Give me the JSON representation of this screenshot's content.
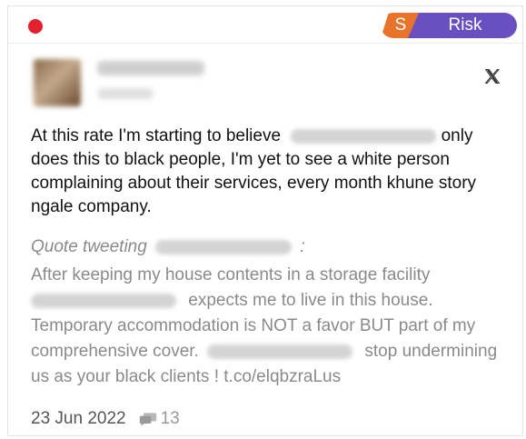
{
  "header": {
    "status_dot_color": "#e5202e",
    "source_tag": "S",
    "source_tag_color": "#e8742c",
    "risk_label": "Risk",
    "risk_color": "#6a4fc0"
  },
  "post": {
    "platform_icon": "x-logo-icon",
    "text_part1": "At this rate I'm starting to believe",
    "text_part2": "only does this to black people, I'm yet to see a white person complaining about their services, every month khune story ngale company.",
    "quote_prefix": "Quote tweeting",
    "quote_suffix": ":",
    "quote_part1": "After keeping my house contents in a storage facility",
    "quote_part2": "expects me to live in this house. Temporary accommodation is NOT a favor BUT part of my comprehensive cover.",
    "quote_part3": "stop undermining us as your black clients ! t.co/elqbzraLus",
    "date": "23 Jun 2022",
    "comment_icon": "comment-icon",
    "comment_count": "13"
  }
}
